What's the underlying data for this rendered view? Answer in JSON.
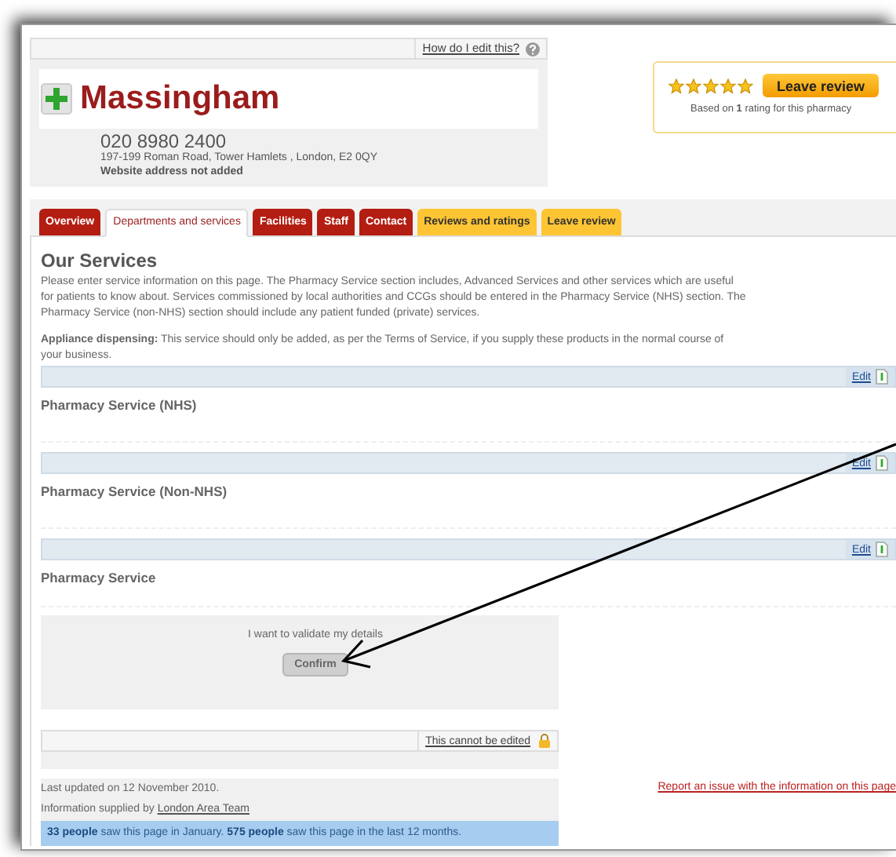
{
  "help_bar": {
    "link": "How do I edit this?"
  },
  "pharmacy": {
    "name": "Massingham",
    "phone": "020 8980 2400",
    "address": "197-199 Roman Road, Tower Hamlets , London, E2 0QY",
    "website": "Website address not added"
  },
  "rating": {
    "stars": 5,
    "button": "Leave review",
    "summary": "Based on **1** rating for this pharmacy"
  },
  "tabs": [
    {
      "label": "Overview",
      "selected": false,
      "kind": "main"
    },
    {
      "label": "Departments and services",
      "selected": true,
      "kind": "main"
    },
    {
      "label": "Facilities",
      "selected": false,
      "kind": "main"
    },
    {
      "label": "Staff",
      "selected": false,
      "kind": "main"
    },
    {
      "label": "Contact",
      "selected": false,
      "kind": "main"
    },
    {
      "label": "Reviews and ratings",
      "selected": false,
      "kind": "review"
    },
    {
      "label": "Leave review",
      "selected": false,
      "kind": "review"
    }
  ],
  "services": {
    "title": "Our Services",
    "intro": "Please enter service information on this page. The Pharmacy Service section includes, Advanced Services and other services which are useful for patients to know about. Services commissioned by local authorities and CCGs should be entered in the Pharmacy Service (NHS) section. The Pharmacy Service (non-NHS) section should include any patient funded (private) services.",
    "note": "**Appliance dispensing:** This service should only be added, as per the Terms of Service, if you supply these products in the normal course of your business.",
    "sections": [
      {
        "edit": "Edit",
        "title": "Pharmacy Service (NHS)"
      },
      {
        "edit": "Edit",
        "title": "Pharmacy Service (Non-NHS)"
      },
      {
        "edit": "Edit",
        "title": "Pharmacy Service"
      }
    ]
  },
  "validate": {
    "text": "I want to validate my details",
    "button": "Confirm"
  },
  "locked": {
    "label": "This cannot be edited"
  },
  "footer": {
    "updated": "Last updated on 12 November 2010.",
    "supplied": "Information supplied by",
    "supplier": "London Area Team",
    "report": "Report an issue with the information on this page",
    "stats": "**33 people** saw this page in January. **575 people** saw this page in the last 12 months."
  }
}
